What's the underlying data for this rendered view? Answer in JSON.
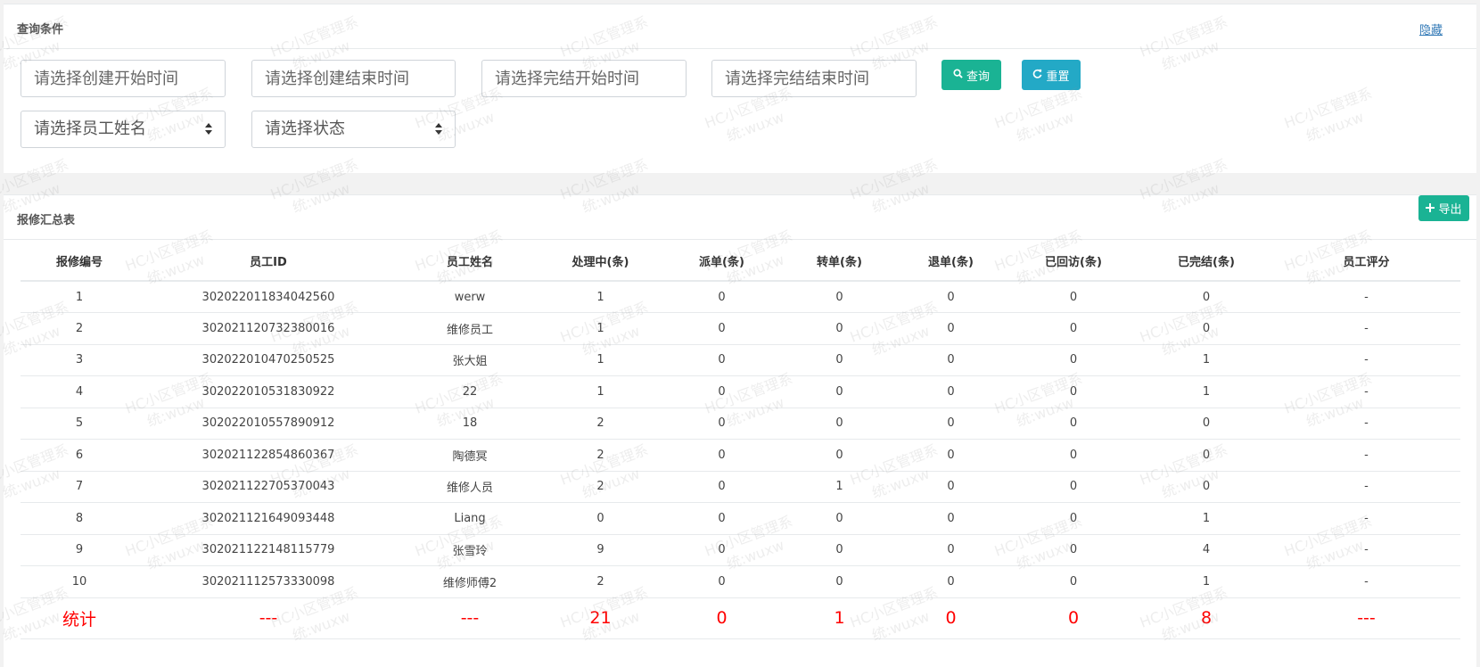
{
  "query": {
    "title": "查询条件",
    "hide_label": "隐藏",
    "create_start_placeholder": "请选择创建开始时间",
    "create_end_placeholder": "请选择创建结束时间",
    "finish_start_placeholder": "请选择完结开始时间",
    "finish_end_placeholder": "请选择完结结束时间",
    "staff_select": "请选择员工姓名",
    "state_select": "请选择状态",
    "search_label": "查询",
    "reset_label": "重置"
  },
  "report": {
    "title": "报修汇总表",
    "export_label": "导出",
    "columns": [
      "报修编号",
      "员工ID",
      "员工姓名",
      "处理中(条)",
      "派单(条)",
      "转单(条)",
      "退单(条)",
      "已回访(条)",
      "已完结(条)",
      "员工评分"
    ],
    "rows": [
      [
        "1",
        "302022011834042560",
        "werw",
        "1",
        "0",
        "0",
        "0",
        "0",
        "0",
        "-"
      ],
      [
        "2",
        "302021120732380016",
        "维修员工",
        "1",
        "0",
        "0",
        "0",
        "0",
        "0",
        "-"
      ],
      [
        "3",
        "302022010470250525",
        "张大姐",
        "1",
        "0",
        "0",
        "0",
        "0",
        "1",
        "-"
      ],
      [
        "4",
        "302022010531830922",
        "22",
        "1",
        "0",
        "0",
        "0",
        "0",
        "1",
        "-"
      ],
      [
        "5",
        "302022010557890912",
        "18",
        "2",
        "0",
        "0",
        "0",
        "0",
        "0",
        "-"
      ],
      [
        "6",
        "302021122854860367",
        "陶德冥",
        "2",
        "0",
        "0",
        "0",
        "0",
        "0",
        "-"
      ],
      [
        "7",
        "302021122705370043",
        "维修人员",
        "2",
        "0",
        "1",
        "0",
        "0",
        "0",
        "-"
      ],
      [
        "8",
        "302021121649093448",
        "Liang",
        "0",
        "0",
        "0",
        "0",
        "0",
        "1",
        "-"
      ],
      [
        "9",
        "302021122148115779",
        "张雪玲",
        "9",
        "0",
        "0",
        "0",
        "0",
        "4",
        "-"
      ],
      [
        "10",
        "302021112573330098",
        "维修师傅2",
        "2",
        "0",
        "0",
        "0",
        "0",
        "1",
        "-"
      ]
    ],
    "total": [
      "统计",
      "---",
      "---",
      "21",
      "0",
      "1",
      "0",
      "0",
      "8",
      "---"
    ]
  },
  "watermark": {
    "line1": "HC小区管理系",
    "line2": "统:wuxw"
  },
  "icons": {
    "search": "search-icon",
    "reset": "refresh-icon",
    "export": "plus-icon"
  },
  "colors": {
    "search_button": "#1ab394",
    "reset_button": "#23a9c6",
    "export_button": "#1ab394",
    "total_text": "#ff0000",
    "link": "#337ab7"
  }
}
